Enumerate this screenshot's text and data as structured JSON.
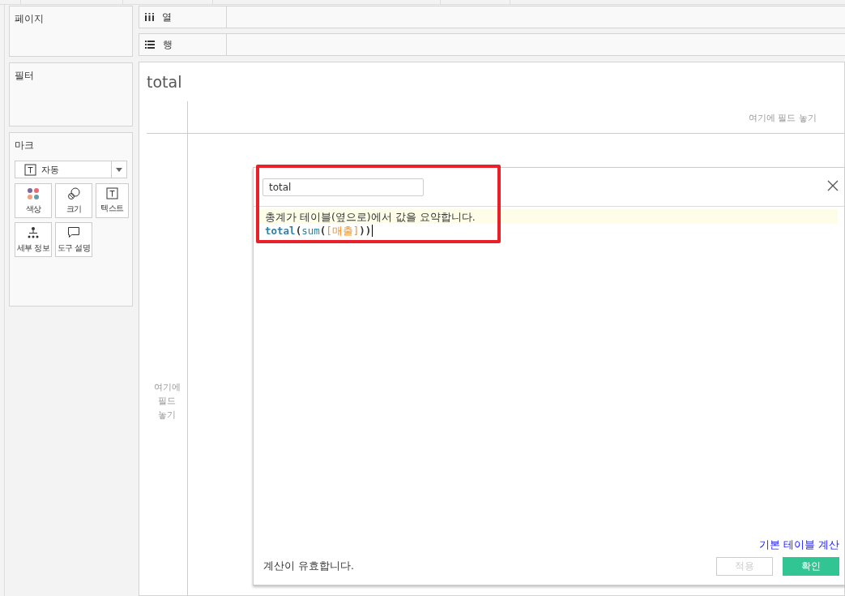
{
  "cards": [
    {
      "kind": "pages",
      "title": "페이지"
    },
    {
      "kind": "filters",
      "title": "필터"
    }
  ],
  "marks": {
    "title": "마크",
    "mark_type": "자동",
    "buttons": [
      {
        "kind": "color",
        "label": "색상"
      },
      {
        "kind": "size",
        "label": "크기"
      },
      {
        "kind": "text",
        "label": "텍스트"
      },
      {
        "kind": "detail",
        "label": "세부 정보"
      },
      {
        "kind": "tooltip",
        "label": "도구 설명"
      }
    ]
  },
  "shelves": [
    {
      "kind": "columns",
      "label": "열"
    },
    {
      "kind": "rows",
      "label": "행"
    }
  ],
  "view": {
    "title": "total",
    "column_drop": "여기에 필드 놓기",
    "row_drop": "여기에\n필드\n놓기"
  },
  "dialog": {
    "name": "total",
    "description": "총계가 테이블(옆으로)에서 값을 요약합니다.",
    "formula": [
      {
        "kind": "function",
        "text": "total"
      },
      {
        "kind": "paren",
        "text": "("
      },
      {
        "kind": "function2",
        "text": "sum"
      },
      {
        "kind": "paren",
        "text": "("
      },
      {
        "kind": "field",
        "text": "[매출]"
      },
      {
        "kind": "paren",
        "text": "))"
      }
    ],
    "link": "기본 테이블 계산",
    "status": "계산이 유효합니다.",
    "buttons": [
      {
        "label": "적용",
        "kind": "secondary",
        "disabled": true
      },
      {
        "label": "확인",
        "kind": "primary",
        "disabled": false
      }
    ]
  }
}
